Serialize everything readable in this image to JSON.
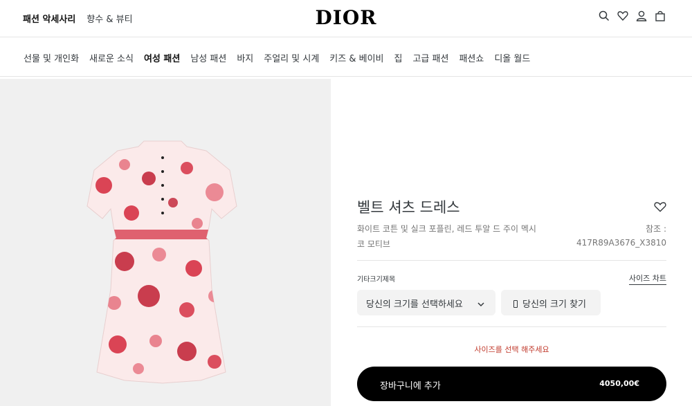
{
  "header": {
    "categories": [
      {
        "label": "패션 악세사리",
        "active": true
      },
      {
        "label": "향수 & 뷰티",
        "active": false
      }
    ],
    "logo": "DIOR",
    "icons": [
      "search-icon",
      "heart-icon",
      "user-icon",
      "bag-icon"
    ]
  },
  "nav": {
    "items": [
      {
        "label": "선물 및 개인화",
        "active": false
      },
      {
        "label": "새로운 소식",
        "active": false
      },
      {
        "label": "여성 패션",
        "active": true
      },
      {
        "label": "남성 패션",
        "active": false
      },
      {
        "label": "바지",
        "active": false
      },
      {
        "label": "주얼리 및 시계",
        "active": false
      },
      {
        "label": "키즈 & 베이비",
        "active": false
      },
      {
        "label": "집",
        "active": false
      },
      {
        "label": "고급 패션",
        "active": false
      },
      {
        "label": "패션쇼",
        "active": false
      },
      {
        "label": "디올 월드",
        "active": false
      }
    ]
  },
  "product": {
    "title": "벨트 셔츠 드레스",
    "description_line1": "화이트 코튼 및 실크 포플린, 레드 투알 드 주이 멕시",
    "description_line2": "코 모티브",
    "ref_label": "참조 :",
    "ref_value": "417R89A3676_X3810",
    "size_label": "기타크기제목",
    "size_chart_label": "사이즈 차트",
    "size_select_placeholder": "당신의 크기를 선택하세요",
    "find_size_label": "당신의 크기 찾기",
    "error_message": "사이즈를 선택 해주세요",
    "add_to_cart_label": "장바구니에 추가",
    "price": "4050,00€"
  },
  "colors": {
    "accent_red": "#c0392b",
    "primary_button": "#000000",
    "gallery_bg": "#f0f0f0"
  }
}
